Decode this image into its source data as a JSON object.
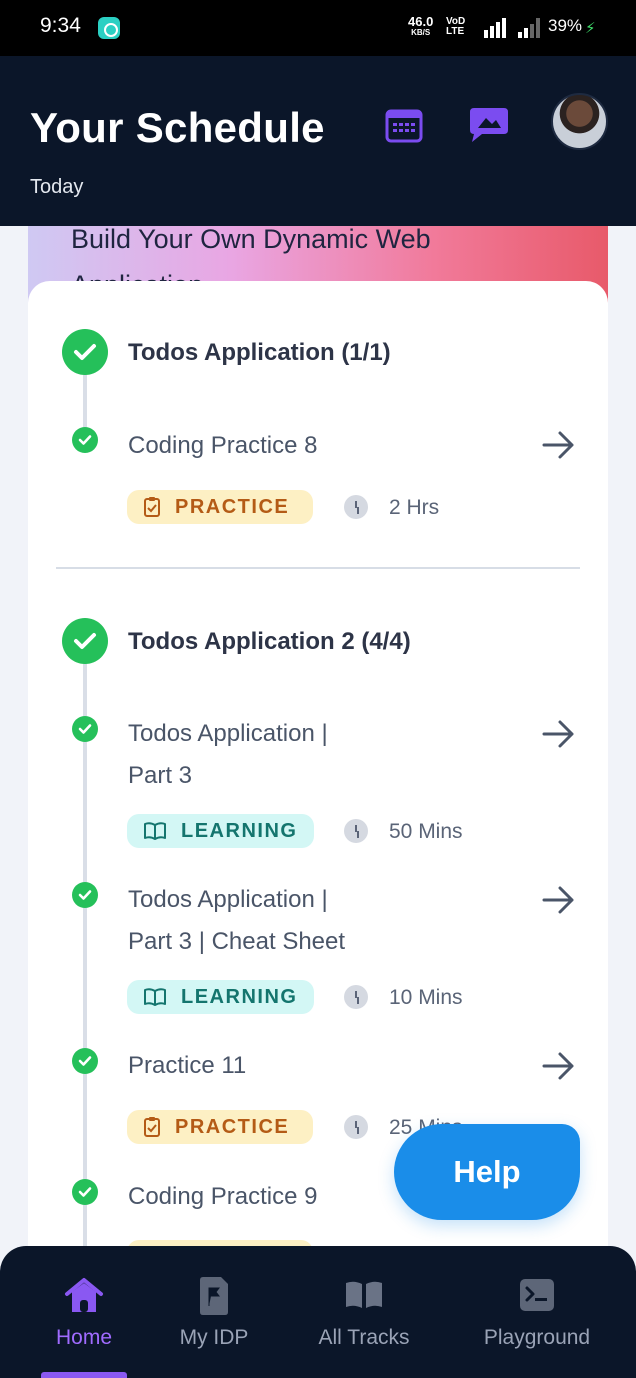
{
  "status_bar": {
    "time": "9:34",
    "net_speed": "46.0",
    "net_unit": "KB/S",
    "volte": "VoD LTE",
    "battery": "39%"
  },
  "header": {
    "title": "Your Schedule",
    "subtitle": "Today"
  },
  "banner": {
    "title": "Build Your Own Dynamic Web Application"
  },
  "sections": [
    {
      "title": "Todos Application (1/1)",
      "items": [
        {
          "title": "Coding Practice 8",
          "tag": "PRACTICE",
          "duration": "2 Hrs"
        }
      ]
    },
    {
      "title": "Todos Application 2 (4/4)",
      "items": [
        {
          "title_line1": "Todos Application |",
          "title_line2": "Part 3",
          "tag": "LEARNING",
          "duration": "50 Mins"
        },
        {
          "title_line1": "Todos Application |",
          "title_line2": "Part 3 | Cheat Sheet",
          "tag": "LEARNING",
          "duration": "10 Mins"
        },
        {
          "title": "Practice 11",
          "tag": "PRACTICE",
          "duration": "25 Mins"
        },
        {
          "title": "Coding Practice 9"
        }
      ]
    }
  ],
  "help_button": "Help",
  "bottom_nav": [
    {
      "label": "Home",
      "active": true
    },
    {
      "label": "My IDP"
    },
    {
      "label": "All Tracks"
    },
    {
      "label": "Playground"
    }
  ],
  "colors": {
    "header_bg": "#0b1629",
    "accent_purple": "#8a58f2",
    "success_green": "#25c05a",
    "help_blue": "#1a8de9"
  }
}
